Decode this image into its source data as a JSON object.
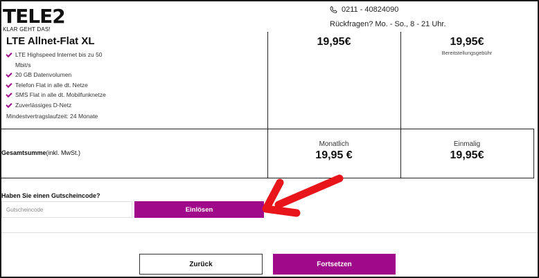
{
  "header": {
    "logo_text": "TELE2",
    "logo_tagline": "KLAR GEHT DAS!",
    "phone": "0211 - 40824090",
    "hours": "Rückfragen? Mo. - So., 8 - 21 Uhr."
  },
  "product": {
    "title": "LTE Allnet-Flat XL",
    "features": [
      "LTE Highspeed Internet bis zu 50 Mbit/s",
      "20 GB Datenvolumen",
      "Telefon Flat in alle dt. Netze",
      "SMS Flat in alle dt. Mobilfunknetze",
      "Zuverlässiges D-Netz"
    ],
    "duration": "Mindestvertragslaufzeit: 24 Monate",
    "monthly_price": "19,95€",
    "setup_price": "19,95€",
    "setup_label": "Bereitstellungsgebühr"
  },
  "total": {
    "label_bold": "Gesamtsumme",
    "label_note": "(inkl. MwSt.)",
    "monthly_label": "Monatlich",
    "monthly_value": "19,95 €",
    "once_label": "Einmalig",
    "once_value": "19,95€"
  },
  "voucher": {
    "question": "Haben Sie einen Gutscheincode?",
    "placeholder": "Gutscheincode",
    "value": "",
    "redeem_label": "Einlösen"
  },
  "nav": {
    "back_label": "Zurück",
    "next_label": "Fortsetzen"
  },
  "colors": {
    "brand": "#a0098a",
    "annotation_arrow": "#e8151b"
  }
}
